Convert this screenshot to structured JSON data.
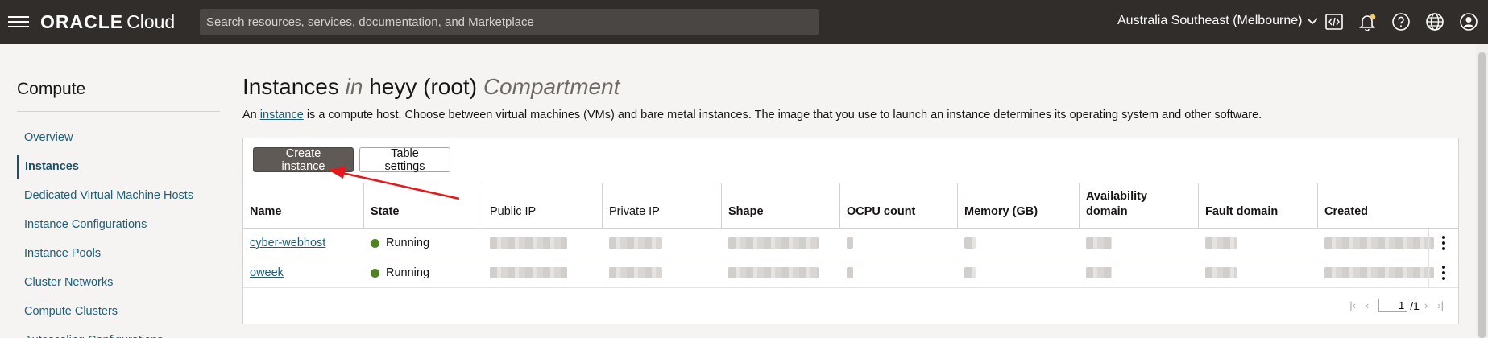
{
  "topbar": {
    "logo_brand": "ORACLE",
    "logo_product": "Cloud",
    "search_placeholder": "Search resources, services, documentation, and Marketplace",
    "region": "Australia Southeast (Melbourne)"
  },
  "sidebar": {
    "heading": "Compute",
    "items": [
      {
        "label": "Overview"
      },
      {
        "label": "Instances"
      },
      {
        "label": "Dedicated Virtual Machine Hosts"
      },
      {
        "label": "Instance Configurations"
      },
      {
        "label": "Instance Pools"
      },
      {
        "label": "Cluster Networks"
      },
      {
        "label": "Compute Clusters"
      },
      {
        "label": "Autoscaling Configurations"
      }
    ]
  },
  "main": {
    "title_a": "Instances",
    "title_in": "in",
    "title_b": "heyy (root)",
    "title_c": "Compartment",
    "desc_prefix": "An",
    "desc_link": "instance",
    "desc_suffix": "is a compute host. Choose between virtual machines (VMs) and bare metal instances. The image that you use to launch an instance determines its operating system and other software.",
    "create_button": "Create instance",
    "table_settings_button": "Table settings",
    "columns": {
      "name": "Name",
      "state": "State",
      "public_ip": "Public IP",
      "private_ip": "Private IP",
      "shape": "Shape",
      "ocpu": "OCPU count",
      "memory": "Memory (GB)",
      "ad_1": "Availability",
      "ad_2": "domain",
      "fault": "Fault domain",
      "created": "Created"
    },
    "rows": [
      {
        "name": "cyber-webhost",
        "state": "Running"
      },
      {
        "name": "oweek",
        "state": "Running"
      }
    ],
    "pager": {
      "current": "1",
      "total": "/1"
    }
  },
  "colors": {
    "running": "#508223",
    "arrow": "#e8171c",
    "topbar": "#312d2a"
  }
}
